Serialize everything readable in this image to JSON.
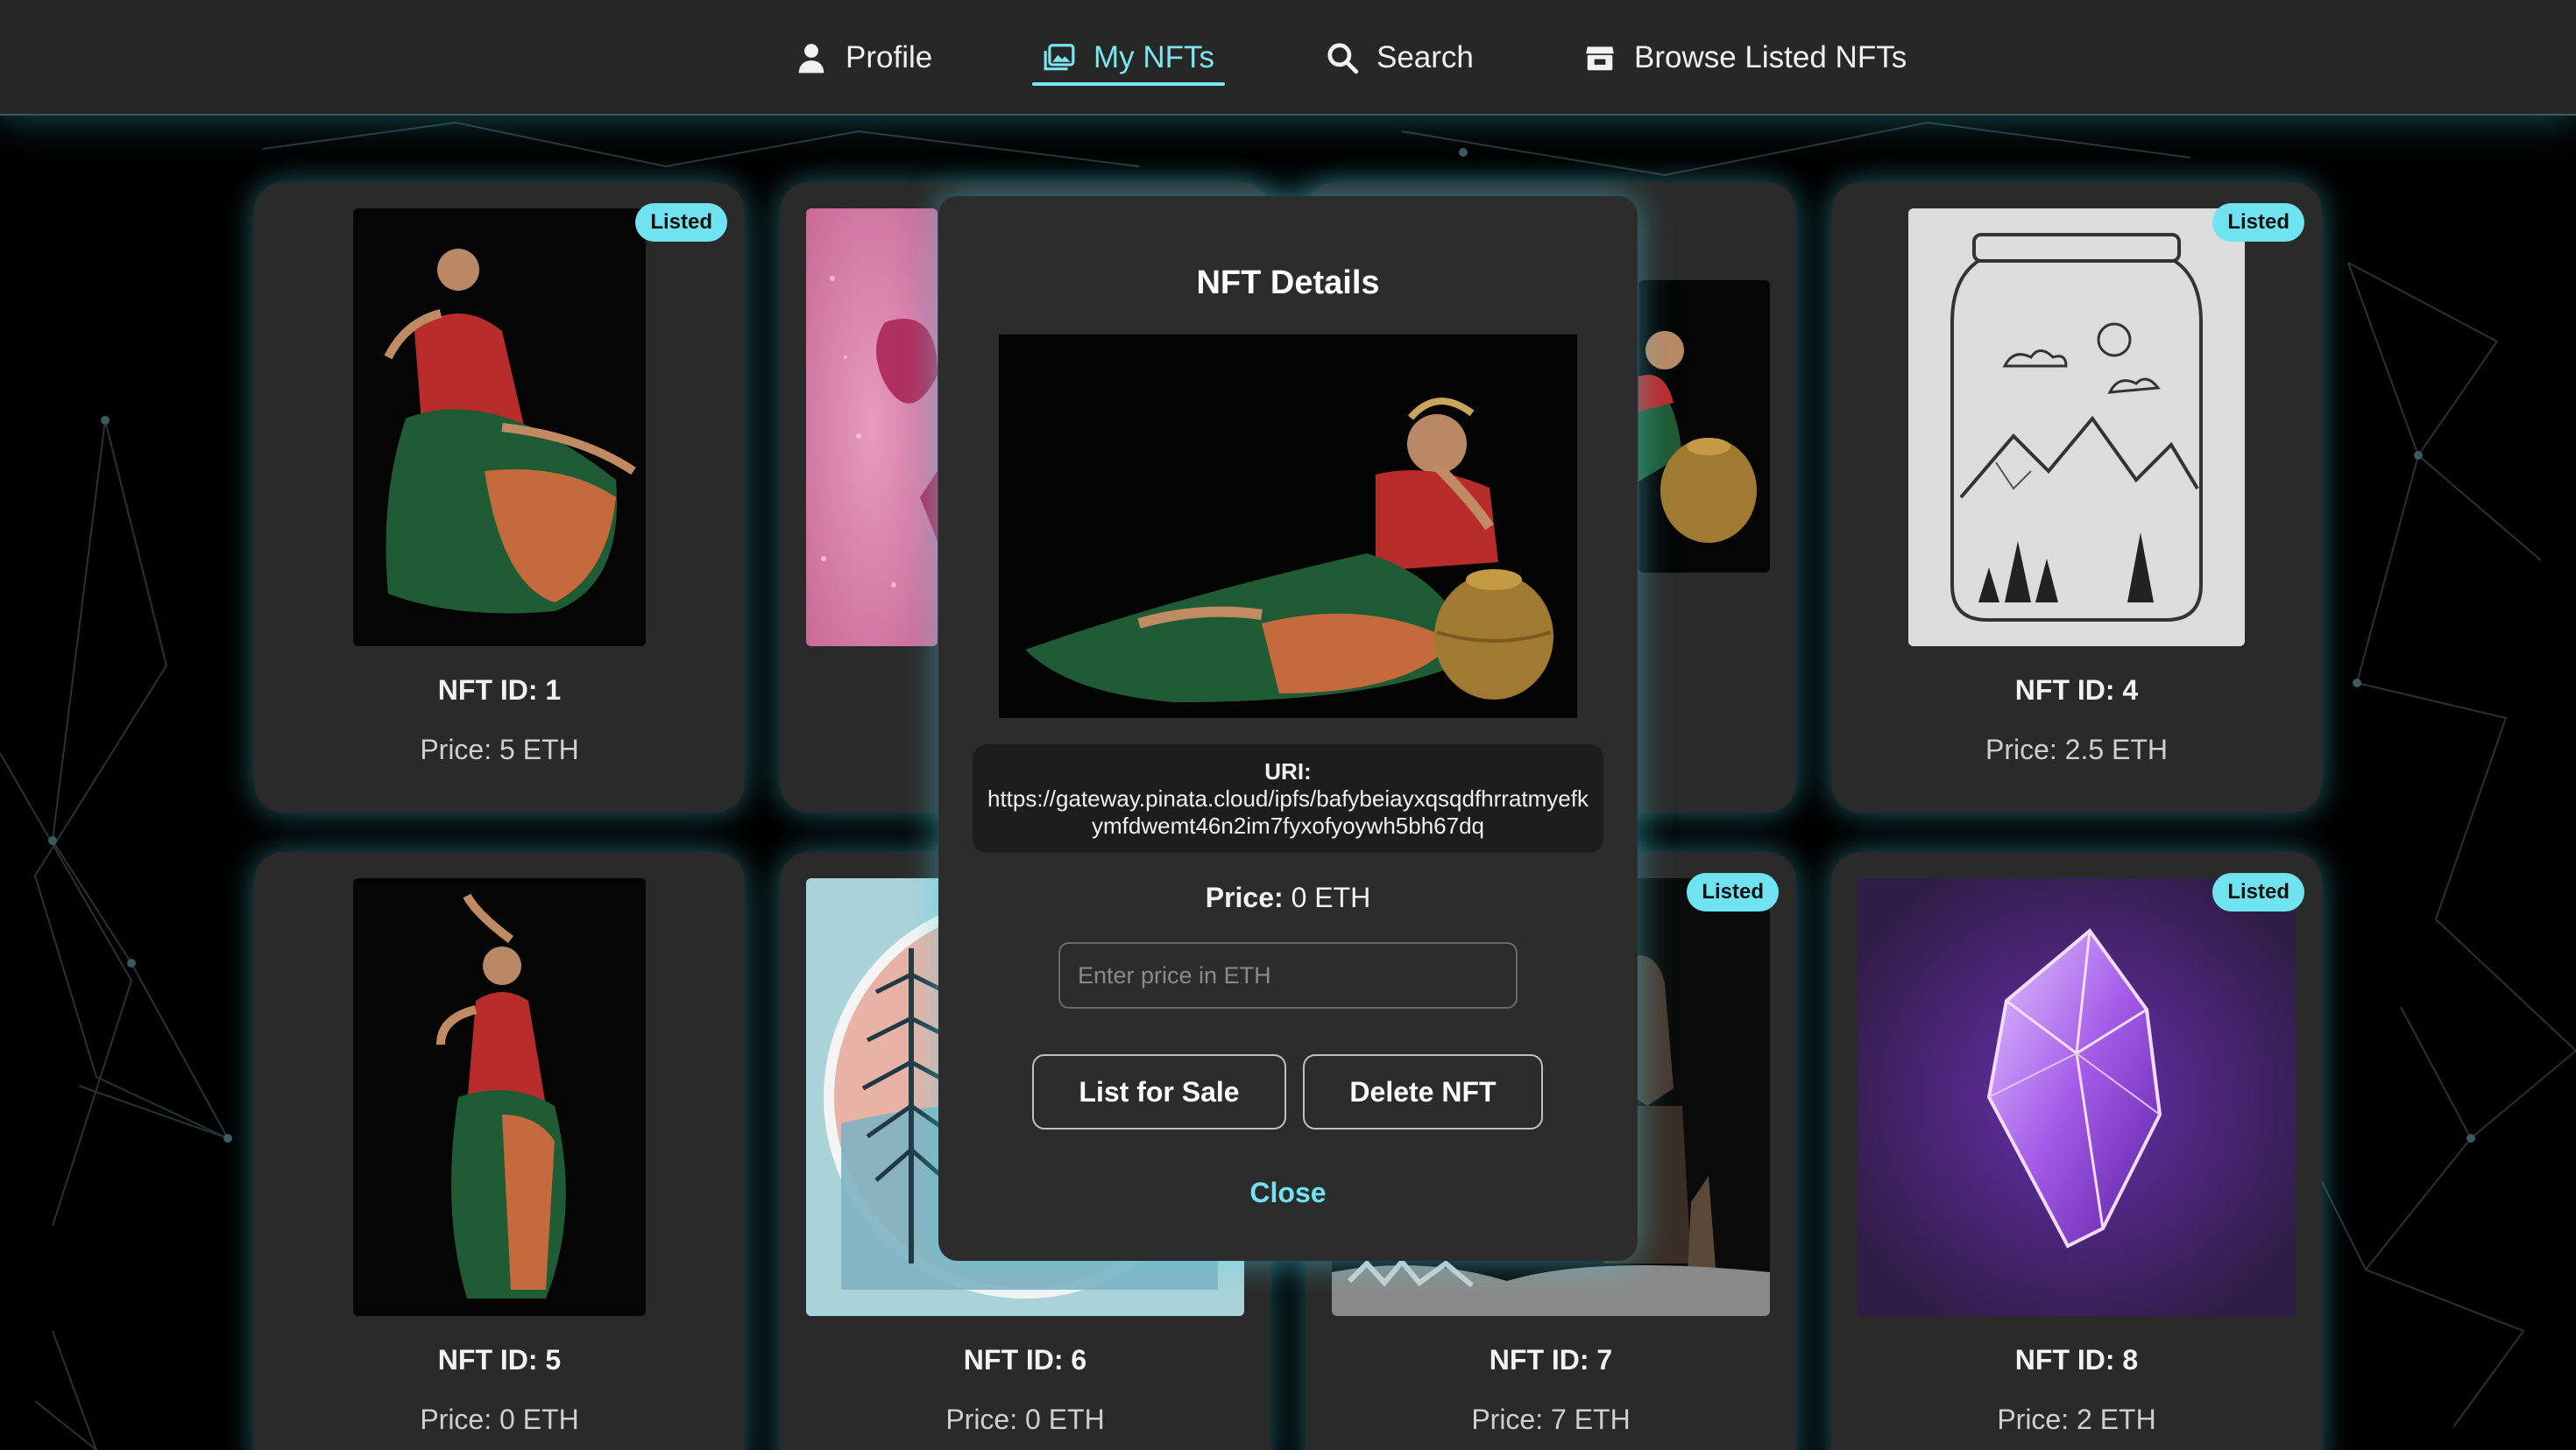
{
  "nav": {
    "profile": "Profile",
    "my_nfts": "My NFTs",
    "search": "Search",
    "browse": "Browse Listed NFTs",
    "active": "my_nfts",
    "accent_color": "#7be6f0"
  },
  "cards": [
    {
      "title": "NFT ID: 1",
      "price": "Price: 5 ETH",
      "badge": "Listed"
    },
    {
      "title": "",
      "price": "",
      "badge": ""
    },
    {
      "title": "",
      "price": "",
      "badge": ""
    },
    {
      "title": "NFT ID: 4",
      "price": "Price: 2.5 ETH",
      "badge": "Listed"
    },
    {
      "title": "NFT ID: 5",
      "price": "Price: 0 ETH",
      "badge": ""
    },
    {
      "title": "NFT ID: 6",
      "price": "Price: 0 ETH",
      "badge": ""
    },
    {
      "title": "NFT ID: 7",
      "price": "Price: 7 ETH",
      "badge": "Listed"
    },
    {
      "title": "NFT ID: 8",
      "price": "Price: 2 ETH",
      "badge": "Listed"
    }
  ],
  "modal": {
    "title": "NFT Details",
    "uri_label": "URI:",
    "uri": "https://gateway.pinata.cloud/ipfs/bafybeiayxqsqdfhrratmyefkymfdwemt46n2im7fyxofyoywh5bh67dq",
    "price_label": "Price:",
    "price_value": "0 ETH",
    "input_placeholder": "Enter price in ETH",
    "list_button": "List for Sale",
    "delete_button": "Delete NFT",
    "close": "Close"
  },
  "colors": {
    "badge": "#6fe4f0",
    "glow": "#50d2e6",
    "card_bg": "#2a2a2a"
  }
}
